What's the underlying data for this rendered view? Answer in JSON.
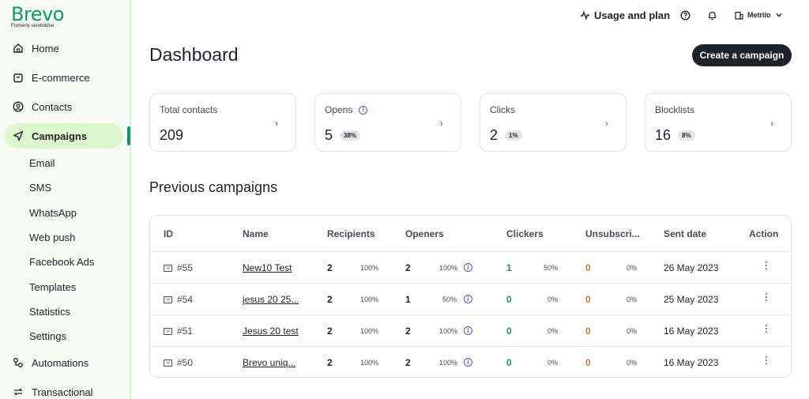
{
  "brand": {
    "name": "Brevo",
    "formerly": "Formerly sendinblue",
    "color": "#0b996e"
  },
  "sidebar": {
    "items": [
      {
        "label": "Home",
        "icon": "home-icon"
      },
      {
        "label": "E-commerce",
        "icon": "shopping-bag-icon"
      },
      {
        "label": "Contacts",
        "icon": "contacts-icon"
      },
      {
        "label": "Campaigns",
        "icon": "send-icon",
        "active": true
      },
      {
        "label": "Automations",
        "icon": "automation-icon"
      },
      {
        "label": "Transactional",
        "icon": "transactional-icon"
      }
    ],
    "sub_items": [
      "Email",
      "SMS",
      "WhatsApp",
      "Web push",
      "Facebook Ads",
      "Templates",
      "Statistics",
      "Settings"
    ]
  },
  "topbar": {
    "usage_label": "Usage and plan",
    "account_name": "Metrilo"
  },
  "page": {
    "title": "Dashboard",
    "create_button": "Create a campaign"
  },
  "stats": [
    {
      "label": "Total contacts",
      "value": "209",
      "pct": ""
    },
    {
      "label": "Opens",
      "value": "5",
      "pct": "38%"
    },
    {
      "label": "Clicks",
      "value": "2",
      "pct": "1%"
    },
    {
      "label": "Blocklists",
      "value": "16",
      "pct": "8%"
    }
  ],
  "campaigns": {
    "title": "Previous campaigns",
    "headers": [
      "ID",
      "Name",
      "Recipients",
      "Openers",
      "Clickers",
      "Unsubscri...",
      "Sent date",
      "Action"
    ],
    "rows": [
      {
        "id": "#55",
        "name": "New10 Test",
        "recipients": "2",
        "recipients_pct": "100%",
        "openers": "2",
        "openers_pct": "100%",
        "clickers": "1",
        "clickers_pct": "50%",
        "unsub": "0",
        "unsub_pct": "0%",
        "date": "26 May 2023"
      },
      {
        "id": "#54",
        "name": "jesus 20 25...",
        "recipients": "2",
        "recipients_pct": "100%",
        "openers": "1",
        "openers_pct": "50%",
        "clickers": "0",
        "clickers_pct": "0%",
        "unsub": "0",
        "unsub_pct": "0%",
        "date": "25 May 2023"
      },
      {
        "id": "#51",
        "name": "Jesus 20 test",
        "recipients": "2",
        "recipients_pct": "100%",
        "openers": "2",
        "openers_pct": "100%",
        "clickers": "0",
        "clickers_pct": "0%",
        "unsub": "0",
        "unsub_pct": "0%",
        "date": "16 May 2023"
      },
      {
        "id": "#50",
        "name": "Brevo uniq...",
        "recipients": "2",
        "recipients_pct": "100%",
        "openers": "2",
        "openers_pct": "100%",
        "clickers": "0",
        "clickers_pct": "0%",
        "unsub": "0",
        "unsub_pct": "0%",
        "date": "16 May 2023"
      }
    ]
  },
  "colors": {
    "accent": "#5b4fc4",
    "green": "#0b996e",
    "orange": "#e5703a",
    "active_bg": "#ddf7cc",
    "sidebar_bg": "#f5fbf2"
  }
}
